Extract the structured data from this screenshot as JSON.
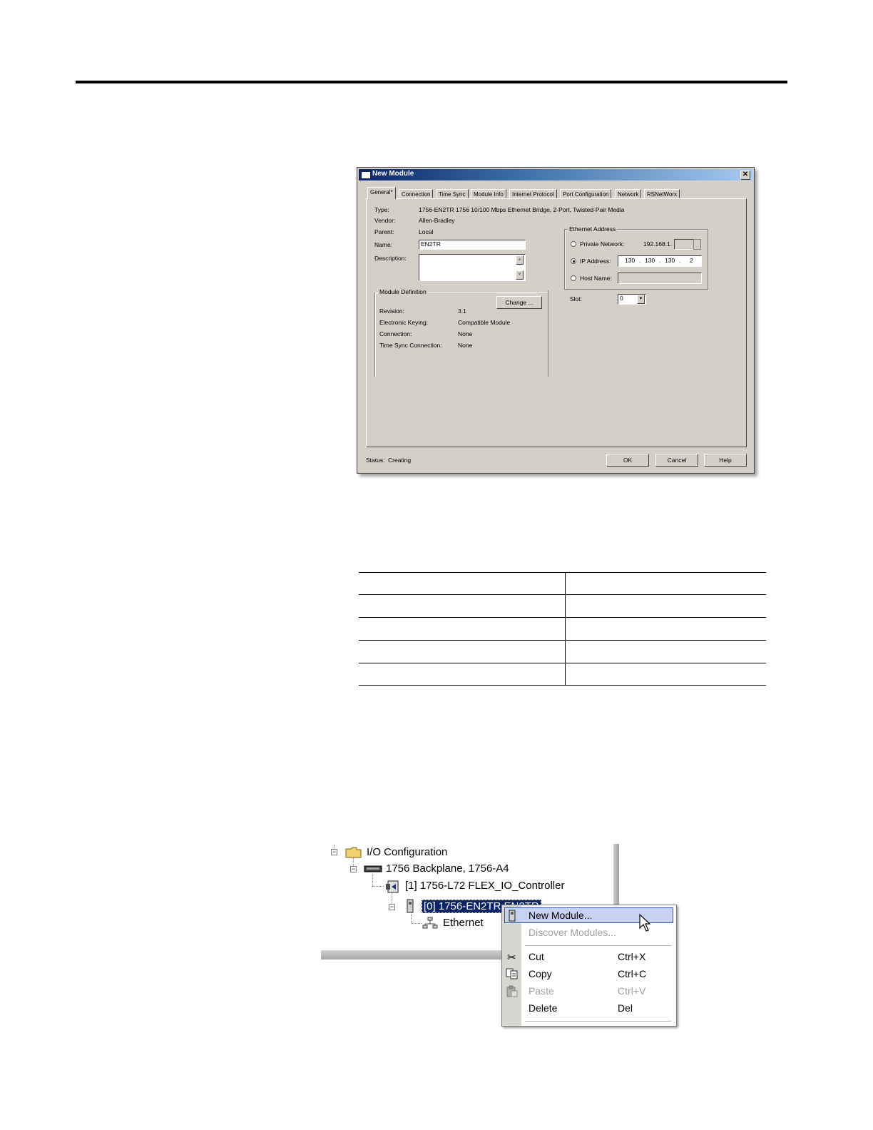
{
  "dialog": {
    "title": "New Module",
    "close_glyph": "✕",
    "tabs": [
      "General*",
      "Connection",
      "Time Sync",
      "Module Info",
      "Internet Protocol",
      "Port Configuration",
      "Network",
      "RSNetWorx"
    ],
    "type_label": "Type:",
    "type_value": "1756-EN2TR 1756 10/100 Mbps Ethernet Bridge, 2-Port, Twisted-Pair Media",
    "vendor_label": "Vendor:",
    "vendor_value": "Allen-Bradley",
    "parent_label": "Parent:",
    "parent_value": "Local",
    "name_label": "Name:",
    "name_value": "EN2TR",
    "description_label": "Description:",
    "description_value": "",
    "module_definition": {
      "group_label": "Module Definition",
      "change_button": "Change ...",
      "revision_label": "Revision:",
      "revision_value": "3.1",
      "keying_label": "Electronic Keying:",
      "keying_value": "Compatible Module",
      "connection_label": "Connection:",
      "connection_value": "None",
      "timesync_label": "Time Sync Connection:",
      "timesync_value": "None"
    },
    "ethernet_address": {
      "group_label": "Ethernet Address",
      "private_label": "Private Network:",
      "private_prefix": "192.168.1.",
      "ip_label": "IP Address:",
      "ip_octets": [
        "130",
        "130",
        "130",
        "2"
      ],
      "ip_dot": ".",
      "host_label": "Host Name:",
      "selected": "IP Address"
    },
    "slot_label": "Slot:",
    "slot_value": "0",
    "status_label": "Status:",
    "status_value": "Creating",
    "ok_button": "OK",
    "cancel_button": "Cancel",
    "help_button": "Help"
  },
  "tree": {
    "items": [
      {
        "label": "I/O Configuration",
        "icon": "folder-icon"
      },
      {
        "label": "1756 Backplane, 1756-A4",
        "icon": "backplane-icon"
      },
      {
        "label": "[1] 1756-L72 FLEX_IO_Controller",
        "icon": "controller-icon"
      },
      {
        "label": "[0] 1756-EN2TR EN2TR",
        "icon": "module-icon"
      },
      {
        "label": "Ethernet",
        "icon": "network-icon"
      }
    ]
  },
  "context_menu": {
    "items": [
      {
        "label": "New Module...",
        "shortcut": "",
        "enabled": true,
        "highlighted": true,
        "icon": "module-icon"
      },
      {
        "label": "Discover Modules...",
        "shortcut": "",
        "enabled": false,
        "icon": ""
      },
      {
        "label": "Cut",
        "shortcut": "Ctrl+X",
        "enabled": true,
        "icon": "scissors-icon"
      },
      {
        "label": "Copy",
        "shortcut": "Ctrl+C",
        "enabled": true,
        "icon": "copy-icon"
      },
      {
        "label": "Paste",
        "shortcut": "Ctrl+V",
        "enabled": false,
        "icon": "paste-icon"
      },
      {
        "label": "Delete",
        "shortcut": "Del",
        "enabled": true,
        "icon": ""
      }
    ]
  },
  "colors": {
    "title_bar": "#0a246a",
    "selection": "#0a246a",
    "menu_highlight": "#c6d3f0",
    "dialog_face": "#d4d0c8"
  }
}
